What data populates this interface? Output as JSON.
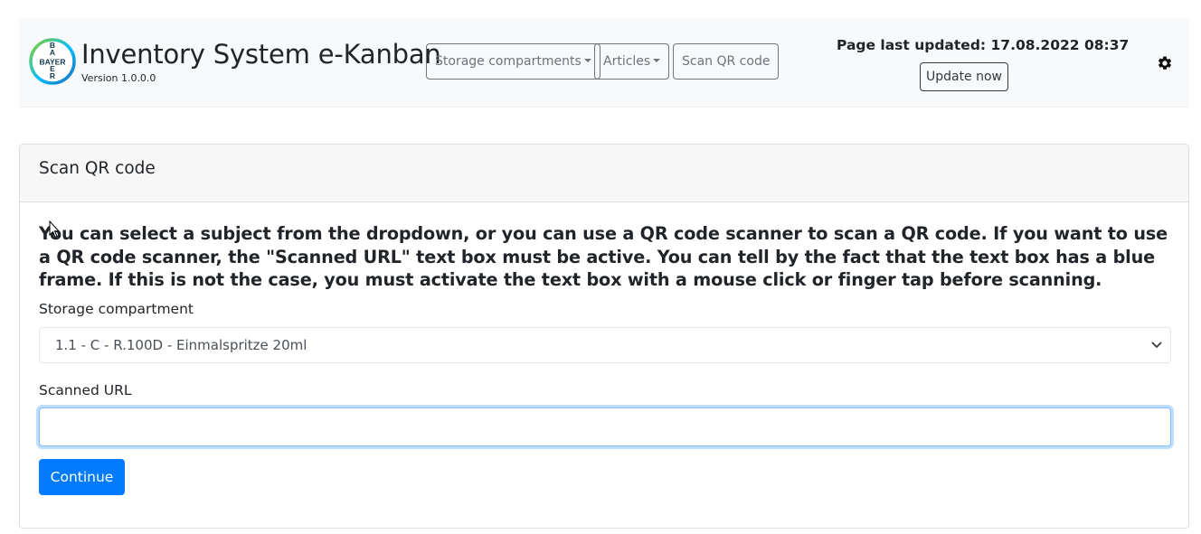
{
  "header": {
    "logo": {
      "text_top": "B",
      "text_mid": "BAYER",
      "text_bottom": "R",
      "colors": [
        "#89d329",
        "#00bcff",
        "#10384f"
      ]
    },
    "title": "Inventory System e-Kanban",
    "version": "Version 1.0.0.0",
    "nav": {
      "storage_compartments": "Storage compartments",
      "articles": "Articles",
      "scan_qr_code": "Scan QR code"
    },
    "last_updated": "Page last updated: 17.08.2022 08:37",
    "update_now": "Update now",
    "settings_icon": "gear-icon"
  },
  "card": {
    "title": "Scan QR code",
    "intro": "You can select a subject from the dropdown, or you can use a QR code scanner to scan a QR code. If you want to use a QR code scanner, the \"Scanned URL\" text box must be active. You can tell by the fact that the text box has a blue frame. If this is not the case, you must activate the text box with a mouse click or finger tap before scanning.",
    "storage_label": "Storage compartment",
    "storage_selected": "1.1 - C - R.100D - Einmalspritze 20ml",
    "scanned_url_label": "Scanned URL",
    "scanned_url_value": "",
    "continue": "Continue"
  },
  "colors": {
    "primary": "#007bff",
    "navbar_bg": "#f8f9fa",
    "focus_border": "#80bdff"
  }
}
